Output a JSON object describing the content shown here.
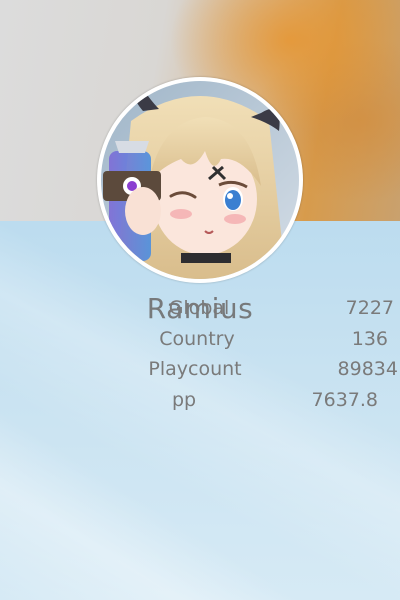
{
  "profile": {
    "username": "Ramius",
    "avatar_icon": "anime-girl-avatar"
  },
  "stats": [
    {
      "label": "Global",
      "value": "7227"
    },
    {
      "label": "Country",
      "value": "136"
    },
    {
      "label": "Playcount",
      "value": "89834"
    },
    {
      "label": "pp",
      "value": "7637.8"
    }
  ],
  "colors": {
    "text": "#7a7a7a",
    "banner_accent": "#d79b4c",
    "panel": "#cfe6f3"
  }
}
